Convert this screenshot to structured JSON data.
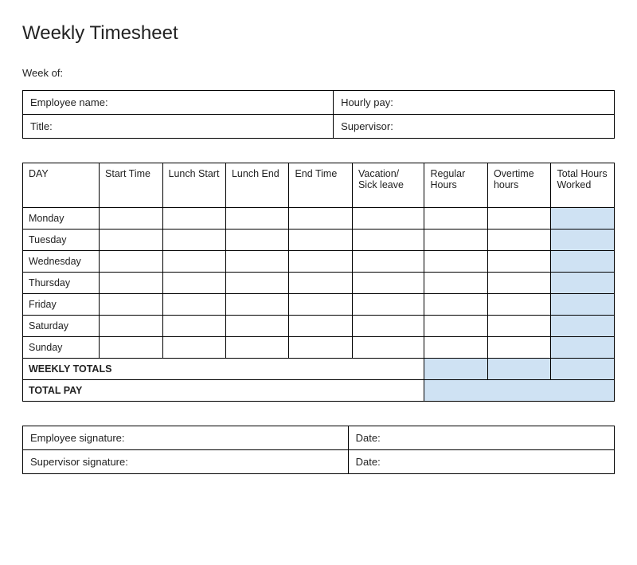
{
  "title": "Weekly Timesheet",
  "week_of_label": "Week of:",
  "info": {
    "employee_name_label": "Employee name:",
    "hourly_pay_label": "Hourly pay:",
    "title_label": "Title:",
    "supervisor_label": "Supervisor:"
  },
  "sheet": {
    "headers": {
      "day": "DAY",
      "start_time": "Start Time",
      "lunch_start": "Lunch Start",
      "lunch_end": "Lunch End",
      "end_time": "End Time",
      "vacation_sick": "Vacation/ Sick leave",
      "regular_hours": "Regular Hours",
      "overtime_hours": "Overtime hours",
      "total_hours": "Total Hours Worked"
    },
    "days": [
      "Monday",
      "Tuesday",
      "Wednesday",
      "Thursday",
      "Friday",
      "Saturday",
      "Sunday"
    ],
    "weekly_totals_label": "WEEKLY TOTALS",
    "total_pay_label": "TOTAL PAY"
  },
  "sig": {
    "employee_sig_label": "Employee signature:",
    "supervisor_sig_label": "Supervisor signature:",
    "date_label": "Date:"
  }
}
